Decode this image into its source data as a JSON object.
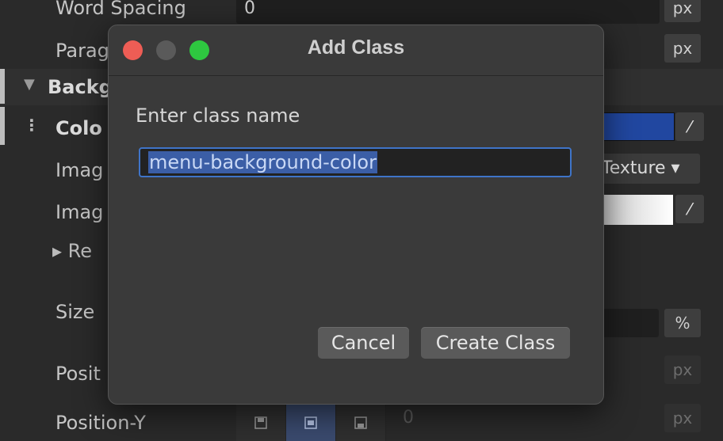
{
  "inspector": {
    "word_spacing_label": "Word Spacing",
    "word_spacing_value": "0",
    "word_spacing_unit": "px",
    "paragraph_label": "Parag",
    "paragraph_unit": "px",
    "background_section": "Backg",
    "color_label": "Colo",
    "image_label_1": "Imag",
    "image_type": "Texture ▾",
    "image_label_2": "Imag",
    "repeat_label": "▸ Re",
    "size_label": "Size",
    "size_unit": "%",
    "position_x_label": "Posit",
    "position_x_unit": "px",
    "position_y_label": "Position-Y",
    "position_y_value": "0",
    "position_y_unit": "px",
    "color_swatch": "#2147a0"
  },
  "dialog": {
    "title": "Add Class",
    "prompt": "Enter class name",
    "input_value": "menu-background-color",
    "cancel_label": "Cancel",
    "create_label": "Create Class"
  },
  "icons": {
    "close": "close-traffic-light-icon",
    "minimize": "minimize-traffic-light-icon",
    "maximize": "maximize-traffic-light-icon",
    "eyedropper": "eyedropper-icon"
  }
}
